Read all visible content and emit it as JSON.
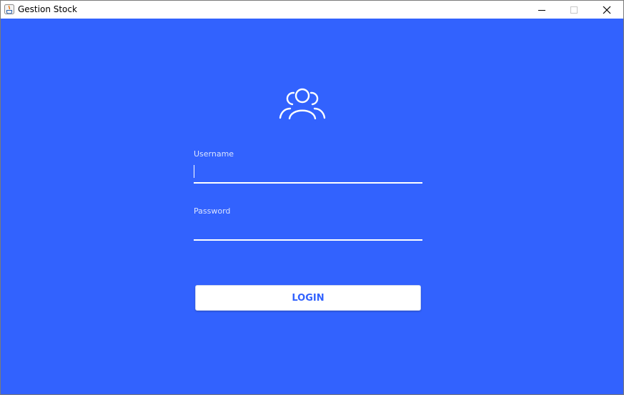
{
  "window": {
    "title": "Gestion Stock",
    "app_icon": "java-icon",
    "controls": [
      "minimize-icon",
      "maximize-icon",
      "close-icon"
    ]
  },
  "login": {
    "header_icon": "users-icon",
    "username_label": "Username",
    "username_value": "",
    "password_label": "Password",
    "password_value": "",
    "login_button_label": "LOGIN"
  },
  "colors": {
    "background": "#3262fe",
    "button_text": "#3262fe",
    "foreground": "#ffffff"
  }
}
